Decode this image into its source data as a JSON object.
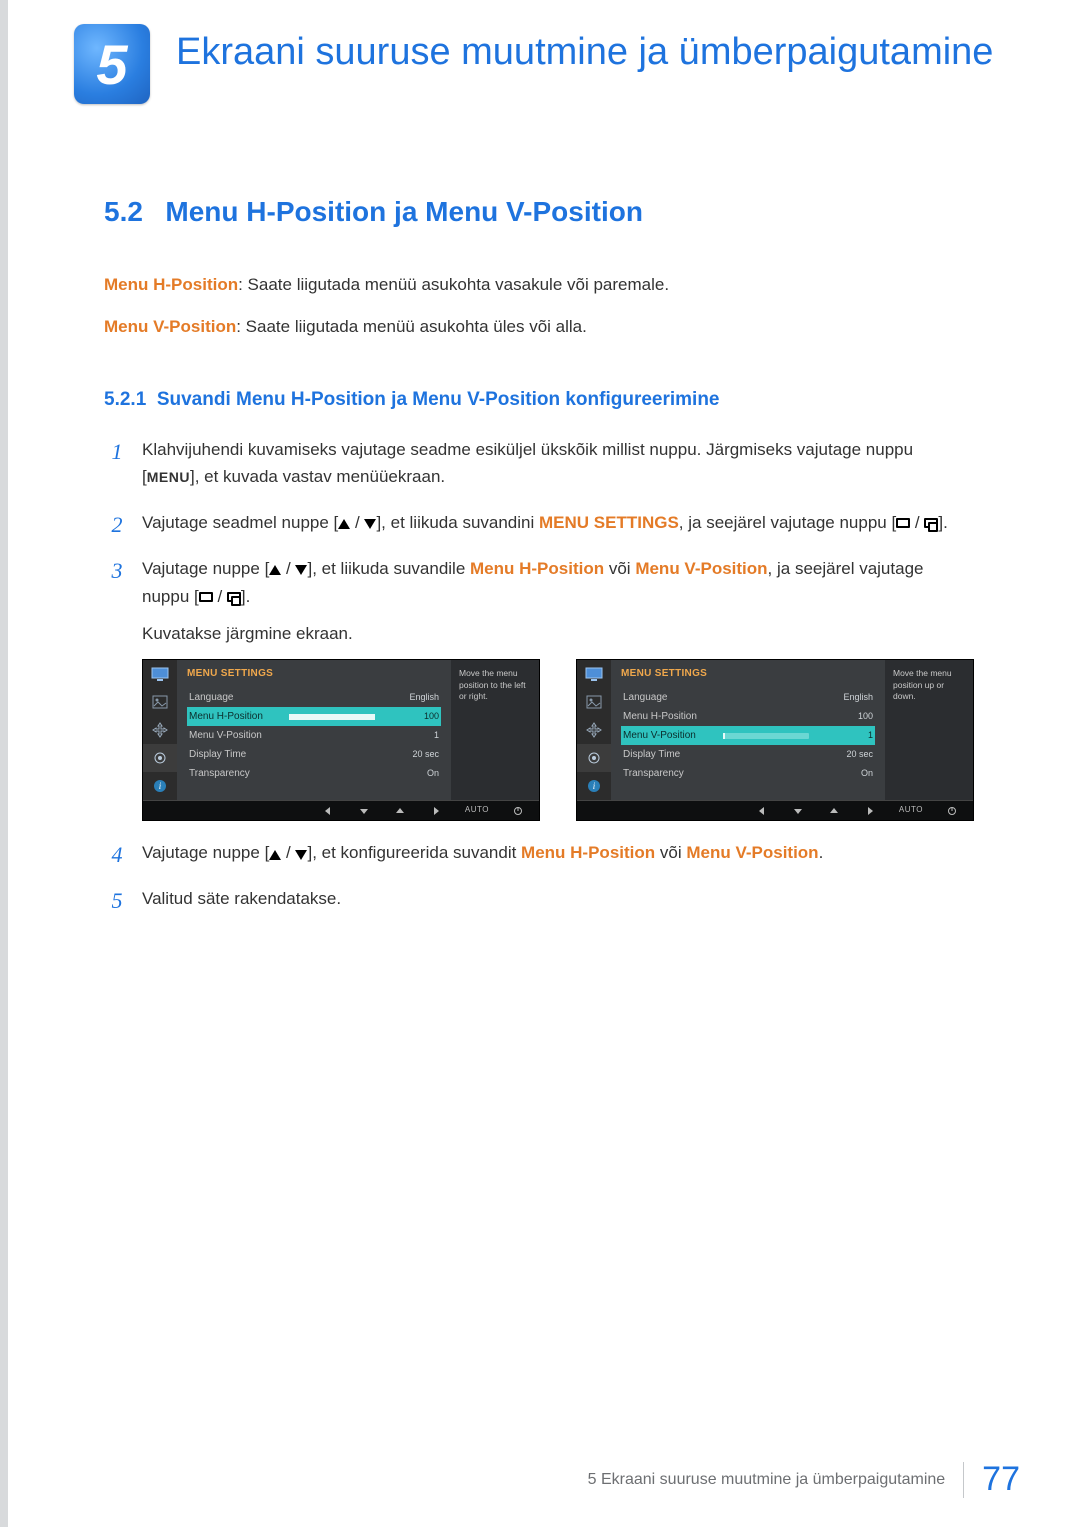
{
  "chapter": {
    "number": "5",
    "title": "Ekraani suuruse muutmine ja ümberpaigutamine"
  },
  "section": {
    "number": "5.2",
    "title": "Menu H-Position ja Menu V-Position"
  },
  "intro": {
    "h_label": "Menu H-Position",
    "h_desc": ": Saate liigutada menüü asukohta vasakule või paremale.",
    "v_label": "Menu V-Position",
    "v_desc": ": Saate liigutada menüü asukohta üles või alla."
  },
  "subsection": {
    "number": "5.2.1",
    "title": "Suvandi Menu H-Position ja Menu V-Position konfigureerimine"
  },
  "steps": {
    "s1a": "Klahvijuhendi kuvamiseks vajutage seadme esiküljel ükskõik millist nuppu. Järgmiseks vajutage nuppu [",
    "s1_menu": "MENU",
    "s1b": "], et kuvada vastav menüüekraan.",
    "s2a": "Vajutage seadmel nuppe [",
    "s2b": "], et liikuda suvandini ",
    "s2_ms": "MENU SETTINGS",
    "s2c": ", ja seejärel vajutage nuppu [",
    "s2d": "].",
    "s3a": "Vajutage nuppe [",
    "s3b": "], et liikuda suvandile ",
    "s3_h": "Menu H-Position",
    "s3_or": " või ",
    "s3_v": "Menu V-Position",
    "s3c": ", ja seejärel vajutage nuppu [",
    "s3d": "].",
    "s3e": "Kuvatakse järgmine ekraan.",
    "s4a": "Vajutage nuppe [",
    "s4b": "], et konfigureerida suvandit ",
    "s4_h": "Menu H-Position",
    "s4_or": " või ",
    "s4_v": "Menu V-Position",
    "s4c": ".",
    "s5": "Valitud säte rakendatakse.",
    "n1": "1",
    "n2": "2",
    "n3": "3",
    "n4": "4",
    "n5": "5"
  },
  "osd": {
    "title": "MENU SETTINGS",
    "rows": {
      "lang_label": "Language",
      "lang_val": "English",
      "h_label": "Menu H-Position",
      "h_val": "100",
      "v_label": "Menu V-Position",
      "v_val": "1",
      "dtime_label": "Display Time",
      "dtime_val": "20 sec",
      "trans_label": "Transparency",
      "trans_val": "On"
    },
    "tip_left": "Move the menu position to the left or right.",
    "tip_right": "Move the menu position up or down.",
    "auto": "AUTO"
  },
  "footer": {
    "text": "5 Ekraani suuruse muutmine ja ümberpaigutamine",
    "page": "77"
  }
}
